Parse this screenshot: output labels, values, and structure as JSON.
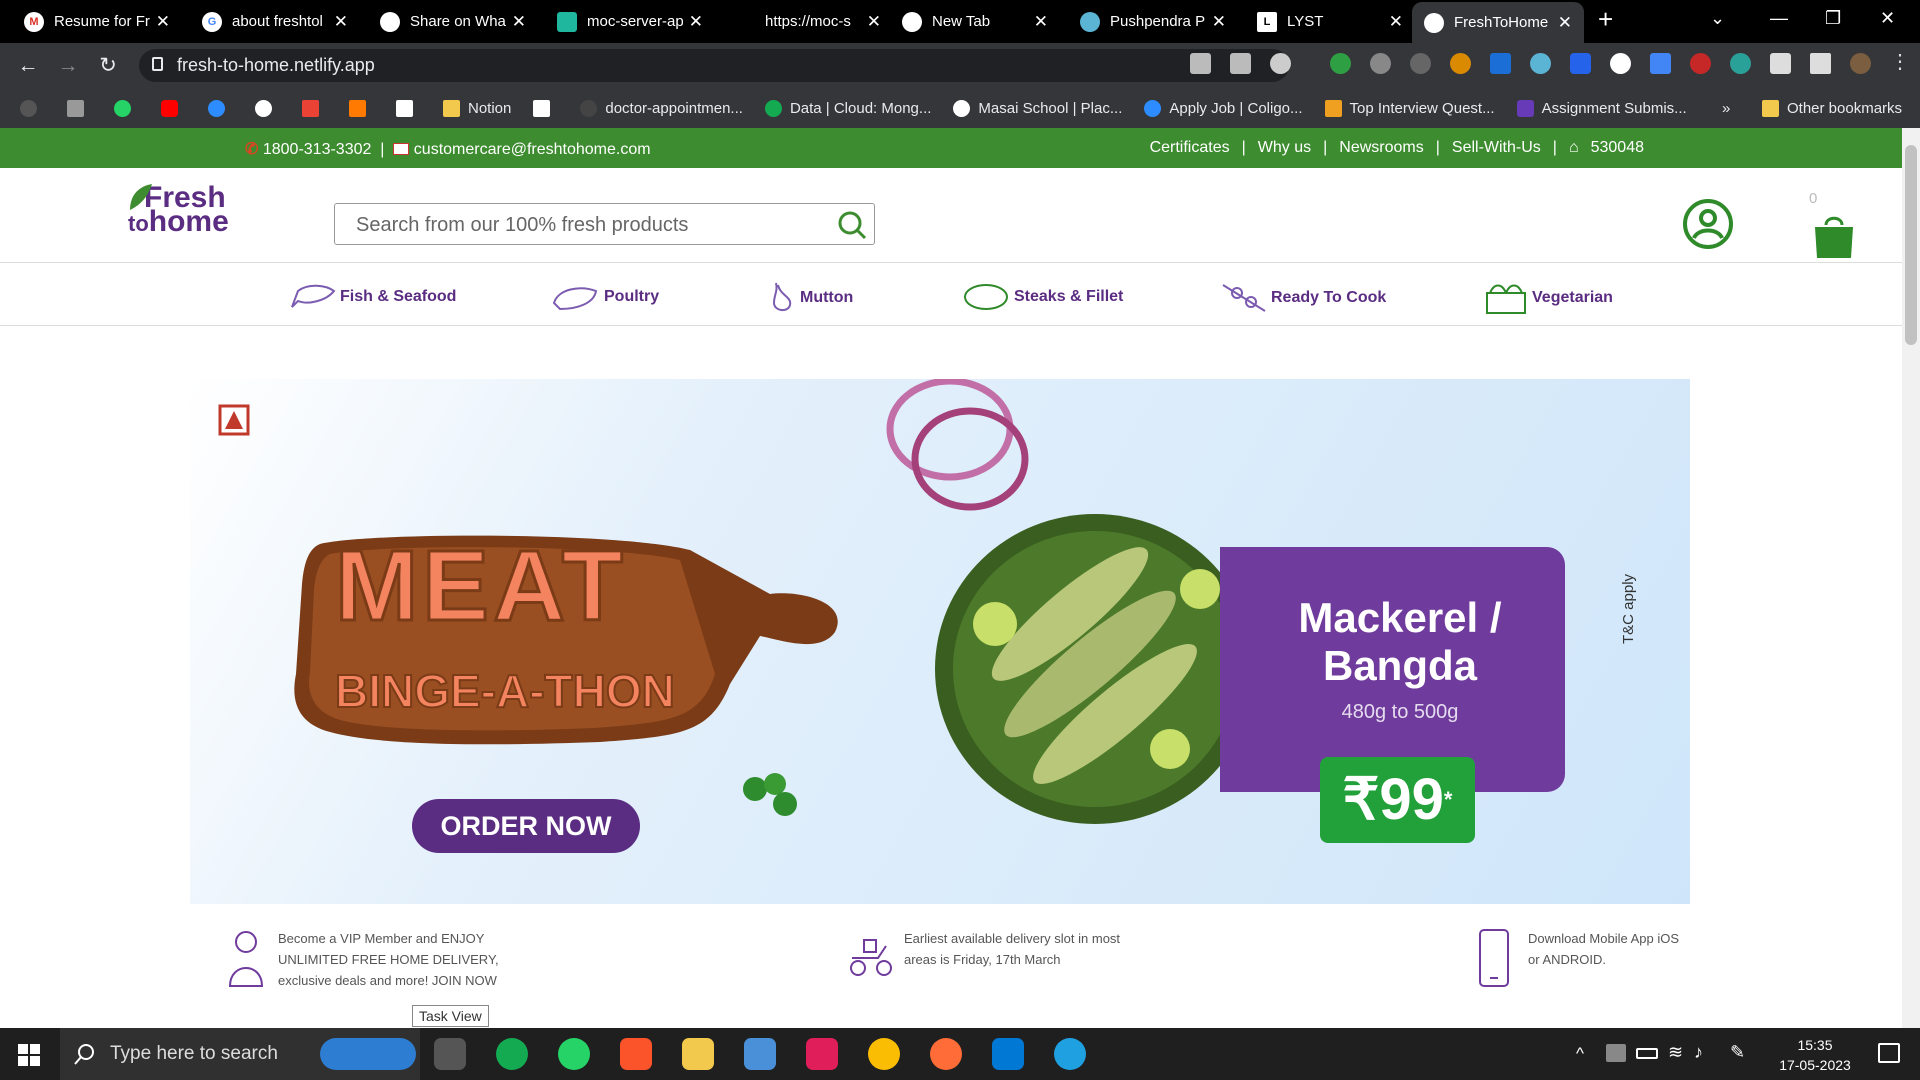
{
  "browser": {
    "tabs": [
      {
        "title": "Resume for Fr",
        "icon": "gmail-icon"
      },
      {
        "title": "about freshtol",
        "icon": "google-icon"
      },
      {
        "title": "Share on Wha",
        "icon": "globe-icon"
      },
      {
        "title": "moc-server-ap",
        "icon": "server-icon"
      },
      {
        "title": "https://moc-s",
        "icon": "blank-icon"
      },
      {
        "title": "New Tab",
        "icon": "chrome-icon"
      },
      {
        "title": "Pushpendra P",
        "icon": "react-icon"
      },
      {
        "title": "LYST",
        "icon": "lyst-icon"
      },
      {
        "title": "FreshToHome",
        "icon": "globe-icon"
      }
    ],
    "url": "fresh-to-home.netlify.app",
    "bookmarks": [
      "Notion",
      "doctor-appointmen...",
      "Data | Cloud: Mong...",
      "Masai School | Plac...",
      "Apply Job | Coligo...",
      "Top Interview Quest...",
      "Assignment Submis..."
    ],
    "bookmarks_overflow": "»",
    "other_bookmarks": "Other bookmarks"
  },
  "topstrip": {
    "phone": "1800-313-3302",
    "email": "customercare@freshtohome.com",
    "links": [
      "Certificates",
      "Why us",
      "Newsrooms",
      "Sell-With-Us"
    ],
    "pincode": "530048"
  },
  "header": {
    "logo_line1": "Fresh",
    "logo_line2": "to",
    "logo_line3": "home",
    "search_placeholder": "Search from our 100% fresh products",
    "cart_count": "0"
  },
  "categories": [
    "Fish & Seafood",
    "Poultry",
    "Mutton",
    "Steaks & Fillet",
    "Ready To Cook",
    "Vegetarian"
  ],
  "banner": {
    "headline1": "MEAT",
    "headline2": "BINGE-A-THON",
    "cta": "ORDER NOW",
    "product_name1": "Mackerel /",
    "product_name2": "Bangda",
    "weight": "480g to 500g",
    "price": "₹99",
    "price_mark": "*",
    "tc": "T&C apply"
  },
  "features": [
    {
      "line1": "Become a VIP Member and ENJOY",
      "line2": "UNLIMITED FREE HOME DELIVERY,",
      "line3": "exclusive deals and more! JOIN NOW"
    },
    {
      "line1": "Earliest available delivery slot in most",
      "line2": "areas is Friday, 17th March",
      "line3": ""
    },
    {
      "line1": "Download Mobile App iOS",
      "line2": "or ANDROID.",
      "line3": ""
    }
  ],
  "taskbar": {
    "search_placeholder": "Type here to search",
    "tooltip": "Task View",
    "time": "15:35",
    "date": "17-05-2023"
  },
  "colors": {
    "brand_green": "#3d8c2f",
    "brand_purple": "#5a2d82",
    "price_green": "#22a03a"
  }
}
